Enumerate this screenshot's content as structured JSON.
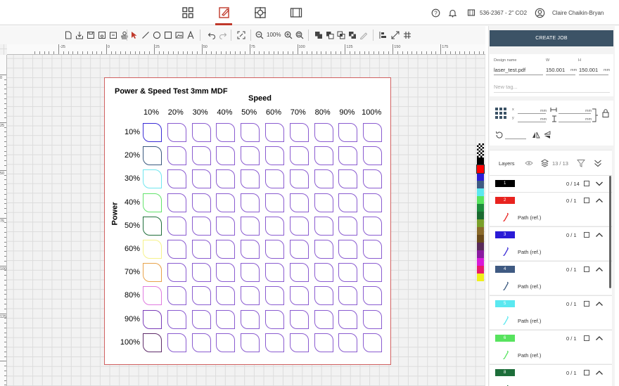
{
  "header": {
    "machine": "536-2367 - 2'' CO2",
    "user": "Claire Chaikin-Bryan"
  },
  "toolbar": {
    "zoom": "100%"
  },
  "ruler": {
    "top": [
      "-25",
      "0",
      "25",
      "50",
      "75",
      "100",
      "125",
      "150",
      "175"
    ],
    "left": [
      "0",
      "25",
      "50",
      "75",
      "100",
      "125"
    ]
  },
  "document": {
    "title": "Power & Speed Test 3mm MDF",
    "speed_label": "Speed",
    "power_label": "Power",
    "columns": [
      "10%",
      "20%",
      "30%",
      "40%",
      "50%",
      "60%",
      "70%",
      "80%",
      "90%",
      "100%"
    ],
    "rows": [
      "10%",
      "20%",
      "30%",
      "40%",
      "50%",
      "60%",
      "70%",
      "80%",
      "90%",
      "100%"
    ],
    "first_column_colors": [
      "#3a2bd6",
      "#39587e",
      "#6fe6ef",
      "#62e36a",
      "#1f6e3a",
      "#f6f28a",
      "#e8a24a",
      "#e07ae0",
      "#7a3bb8",
      "#5e2b6a"
    ],
    "grid_color": "#8a5bd0"
  },
  "panel": {
    "create_job": "CREATE JOB",
    "design_name_label": "Design name",
    "design_name": "laser_test.pdf",
    "w_label": "W",
    "h_label": "H",
    "w_value": "150.001",
    "h_value": "150.001",
    "unit": "mm",
    "new_tag": "New tag...",
    "x_label": "x",
    "y_label": "y",
    "layers_label": "Layers",
    "layers_count": "13 / 13"
  },
  "palette": [
    "#000000",
    "#ff0000",
    "#2a1bd6",
    "#3f5a82",
    "#5be8f0",
    "#57e35e",
    "#1d8c3c",
    "#1a6a30",
    "#7aa02a",
    "#8a6a2a",
    "#6a4a1a",
    "#5a2a5a",
    "#8a1aa0",
    "#d81ad8",
    "#e81a6a",
    "#f0f01a"
  ],
  "layers": [
    {
      "num": "1",
      "color": "#000000",
      "count": "0 / 14",
      "expanded": false
    },
    {
      "num": "2",
      "color": "#e8231f",
      "count": "0 / 1",
      "expanded": true,
      "path": "Path (ref.)",
      "path_color": "#e8231f"
    },
    {
      "num": "3",
      "color": "#2a1bd6",
      "count": "0 / 1",
      "expanded": true,
      "path": "Path (ref.)",
      "path_color": "#3a2bd6"
    },
    {
      "num": "4",
      "color": "#3f5a82",
      "count": "0 / 1",
      "expanded": true,
      "path": "Path (ref.)",
      "path_color": "#39587e"
    },
    {
      "num": "5",
      "color": "#5be8f0",
      "count": "0 / 1",
      "expanded": true,
      "path": "Path (ref.)",
      "path_color": "#5be8f0"
    },
    {
      "num": "6",
      "color": "#57e35e",
      "count": "0 / 1",
      "expanded": true,
      "path": "Path (ref.)",
      "path_color": "#57e35e"
    },
    {
      "num": "8",
      "color": "#1d6e3a",
      "count": "0 / 1",
      "expanded": true,
      "path": "",
      "path_color": "#1d6e3a"
    }
  ]
}
